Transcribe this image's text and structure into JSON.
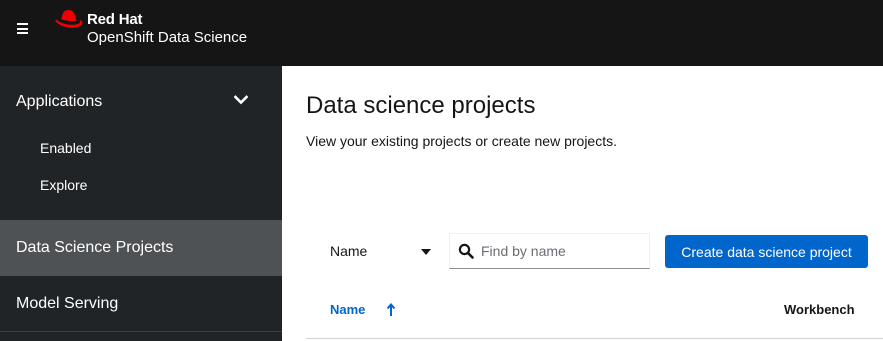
{
  "masthead": {
    "brand_line1": "Red Hat",
    "brand_line2": "OpenShift Data Science",
    "menu_icon": "hamburger-icon",
    "logo_icon": "red-hat-logo",
    "colors": {
      "background": "#151515",
      "logo_red": "#ee0000"
    }
  },
  "sidebar": {
    "group": {
      "label": "Applications",
      "expanded": true,
      "icon": "chevron-down-icon",
      "items": [
        {
          "label": "Enabled"
        },
        {
          "label": "Explore"
        }
      ]
    },
    "items": [
      {
        "label": "Data Science Projects",
        "active": true
      },
      {
        "label": "Model Serving",
        "active": false
      }
    ],
    "colors": {
      "background": "#212427",
      "active_background": "#4f5255"
    }
  },
  "main": {
    "title": "Data science projects",
    "description": "View your existing projects or create new projects.",
    "toolbar": {
      "filter_label": "Name",
      "search_placeholder": "Find by name",
      "search_icon": "search-icon",
      "create_button": "Create data science project"
    },
    "table": {
      "columns": [
        {
          "label": "Name",
          "sorted": "ascending",
          "sort_icon": "sort-ascending-icon"
        },
        {
          "label": "Workbench"
        }
      ]
    },
    "colors": {
      "primary": "#0066cc"
    }
  }
}
